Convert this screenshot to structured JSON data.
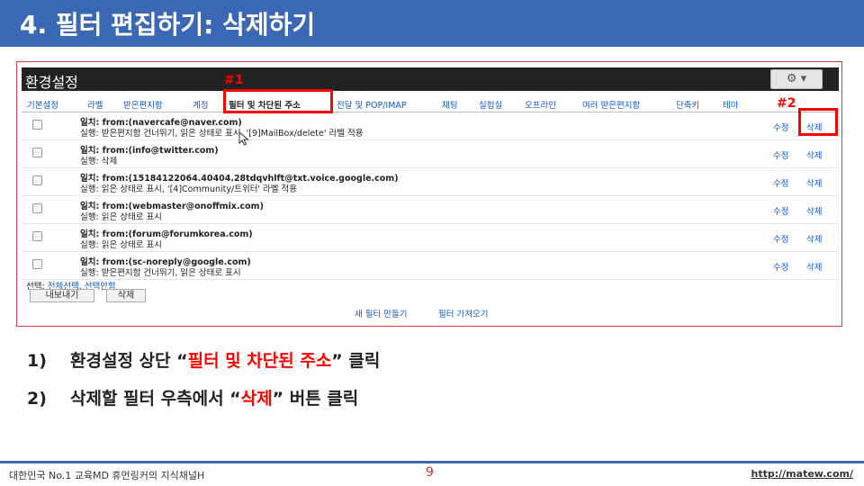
{
  "slide": {
    "title": "4. 필터 편집하기: 삭제하기",
    "page_number": "9",
    "footer_left": "대한민국 No.1 교육MD 휴먼링커의 지식채널H",
    "footer_url": "http://matew.com/"
  },
  "gmail": {
    "header_title": "환경설정",
    "gear_label": "⚙ ▾",
    "tabs": [
      "기본설정",
      "라벨",
      "받은편지함",
      "계정",
      "필터 및 차단된 주소",
      "전달 및 POP/IMAP",
      "채팅",
      "실험실",
      "오프라인",
      "여러 받은편지함",
      "단축키",
      "테마"
    ],
    "filters": [
      {
        "criteria": "일치: from:(navercafe@naver.com)",
        "action": "실행: 받은편지함 건너뛰기, 읽은 상태로 표시, '[9]MailBox/delete' 라벨 적용"
      },
      {
        "criteria": "일치: from:(info@twitter.com)",
        "action": "실행: 삭제"
      },
      {
        "criteria": "일치: from:(15184122064.40404.28tdqvhlft@txt.voice.google.com)",
        "action": "실행: 읽은 상태로 표시, '[4]Community/트위터' 라벨 적용"
      },
      {
        "criteria": "일치: from:(webmaster@onoffmix.com)",
        "action": "실행: 읽은 상태로 표시"
      },
      {
        "criteria": "일치: from:(forum@forumkorea.com)",
        "action": "실행: 읽은 상태로 표시"
      },
      {
        "criteria": "일치: from:(sc-noreply@google.com)",
        "action": "실행: 받은편지함 건너뛰기, 읽은 상태로 표시"
      }
    ],
    "edit_label": "수정",
    "delete_label": "삭제",
    "select_label": "선택:",
    "select_all": "전체선택",
    "select_none": "선택안함",
    "export_button": "내보내기",
    "delete_button": "삭제",
    "new_filter_link": "새 필터 만들기",
    "import_filter_link": "필터 가져오기"
  },
  "annotations": {
    "marker1": "#1",
    "marker2": "#2"
  },
  "instructions": [
    {
      "num": "1)",
      "pre": "환경설정 상단 “",
      "highlight": "필터 및 차단된 주소",
      "post": "” 클릭"
    },
    {
      "num": "2)",
      "pre": "삭제할 필터 우측에서 “",
      "highlight": "삭제",
      "post": "” 버튼 클릭"
    }
  ],
  "colors": {
    "title_bar": "#3b68b4",
    "highlight_red": "#ff0000",
    "link_blue": "#1155cc"
  }
}
